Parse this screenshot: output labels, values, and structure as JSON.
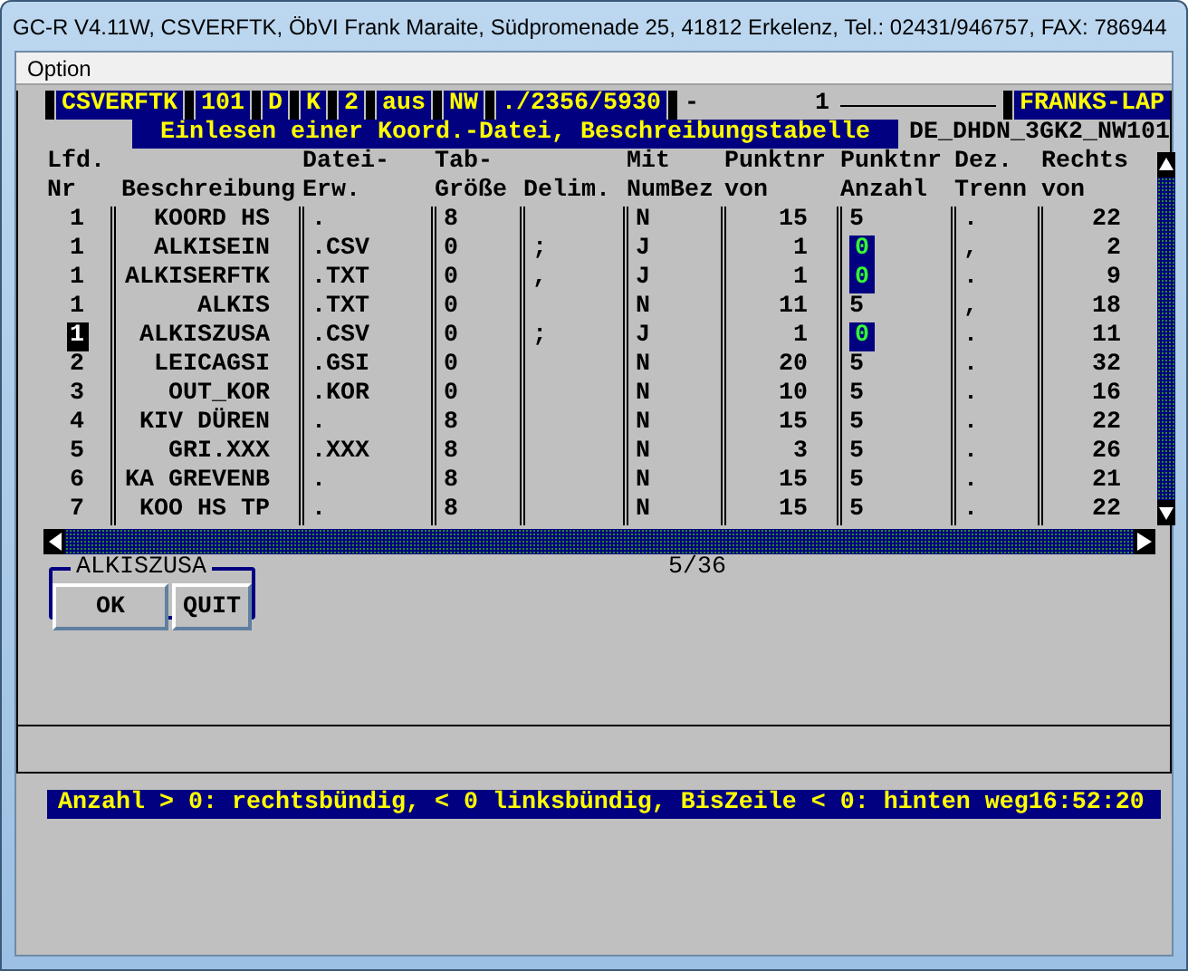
{
  "window": {
    "title": "GC-R V4.11W, CSVERFTK, ÖbVI Frank Maraite, Südpromenade 25, 41812 Erkelenz, Tel.: 02431/946757, FAX: 786944"
  },
  "menu": [
    {
      "label": "Option"
    }
  ],
  "top_fields": [
    {
      "text": "CSVERFTK",
      "highlighted": true
    },
    {
      "text": "101",
      "highlighted": true
    },
    {
      "text": "D",
      "highlighted": true
    },
    {
      "text": "K",
      "highlighted": true
    },
    {
      "text": "2",
      "highlighted": true
    },
    {
      "text": "aus",
      "highlighted": true
    },
    {
      "text": "NW",
      "highlighted": true
    },
    {
      "text": "./2356/5930",
      "highlighted": true
    },
    {
      "text": "-        1",
      "highlighted": false
    },
    {
      "text": "FRANKS-LAP",
      "highlighted": true
    }
  ],
  "heading": {
    "title": "Einlesen einer Koord.-Datei, Beschreibungstabelle",
    "file": "DE_DHDN_3GK2_NW101"
  },
  "table": {
    "columns": [
      {
        "line1": "Lfd.",
        "line2": "Nr"
      },
      {
        "line2": "Beschreibung"
      },
      {
        "line1": "Datei-",
        "line2": "Erw."
      },
      {
        "line1": "Tab-",
        "line2": "Größe"
      },
      {
        "line2": "Delim."
      },
      {
        "line1": "Mit",
        "line2": "NumBez"
      },
      {
        "line1": "Punktnr",
        "line2": "von"
      },
      {
        "line1": "Punktnr",
        "line2": "Anzahl"
      },
      {
        "line1": "Dez.",
        "line2": "Trenn"
      },
      {
        "line1": "Rechts",
        "line2": "von"
      }
    ],
    "rows": [
      {
        "selected": false,
        "anzahl_highlighted": false,
        "cells": [
          "1",
          "KOORD HS",
          ".",
          "8",
          "",
          "N",
          "15",
          "5",
          ".",
          "22"
        ]
      },
      {
        "selected": false,
        "anzahl_highlighted": true,
        "cells": [
          "1",
          "ALKISEIN",
          ".CSV",
          "0",
          ";",
          "J",
          "1",
          "0",
          ",",
          "2"
        ]
      },
      {
        "selected": false,
        "anzahl_highlighted": true,
        "cells": [
          "1",
          "ALKISERFTK",
          ".TXT",
          "0",
          ",",
          "J",
          "1",
          "0",
          ".",
          "9"
        ]
      },
      {
        "selected": false,
        "anzahl_highlighted": false,
        "cells": [
          "1",
          "ALKIS",
          ".TXT",
          "0",
          "",
          "N",
          "11",
          "5",
          ",",
          "18"
        ]
      },
      {
        "selected": true,
        "anzahl_highlighted": true,
        "cells": [
          "1",
          "ALKISZUSA",
          ".CSV",
          "0",
          ";",
          "J",
          "1",
          "0",
          ".",
          "11"
        ]
      },
      {
        "selected": false,
        "anzahl_highlighted": false,
        "cells": [
          "2",
          "LEICAGSI",
          ".GSI",
          "0",
          "",
          "N",
          "20",
          "5",
          ".",
          "32"
        ]
      },
      {
        "selected": false,
        "anzahl_highlighted": false,
        "cells": [
          "3",
          "OUT_KOR",
          ".KOR",
          "0",
          "",
          "N",
          "10",
          "5",
          ".",
          "16"
        ]
      },
      {
        "selected": false,
        "anzahl_highlighted": false,
        "cells": [
          "4",
          "KIV DÜREN",
          ".",
          "8",
          "",
          "N",
          "15",
          "5",
          ".",
          "22"
        ]
      },
      {
        "selected": false,
        "anzahl_highlighted": false,
        "cells": [
          "5",
          "GRI.XXX",
          ".XXX",
          "8",
          "",
          "N",
          "3",
          "5",
          ".",
          "26"
        ]
      },
      {
        "selected": false,
        "anzahl_highlighted": false,
        "cells": [
          "6",
          "KA GREVENB",
          ".",
          "8",
          "",
          "N",
          "15",
          "5",
          ".",
          "21"
        ]
      },
      {
        "selected": false,
        "anzahl_highlighted": false,
        "cells": [
          "7",
          "KOO HS TP",
          ".",
          "8",
          "",
          "N",
          "15",
          "5",
          ".",
          "22"
        ]
      }
    ]
  },
  "page": "5/36",
  "group": {
    "title": "ALKISZUSA",
    "buttons": [
      "OK",
      "QUIT"
    ]
  },
  "status_bar": {
    "text": "Anzahl > 0: rechtsbündig, < 0 linksbündig, BisZeile < 0: hinten weg",
    "time": "16:52:20"
  }
}
